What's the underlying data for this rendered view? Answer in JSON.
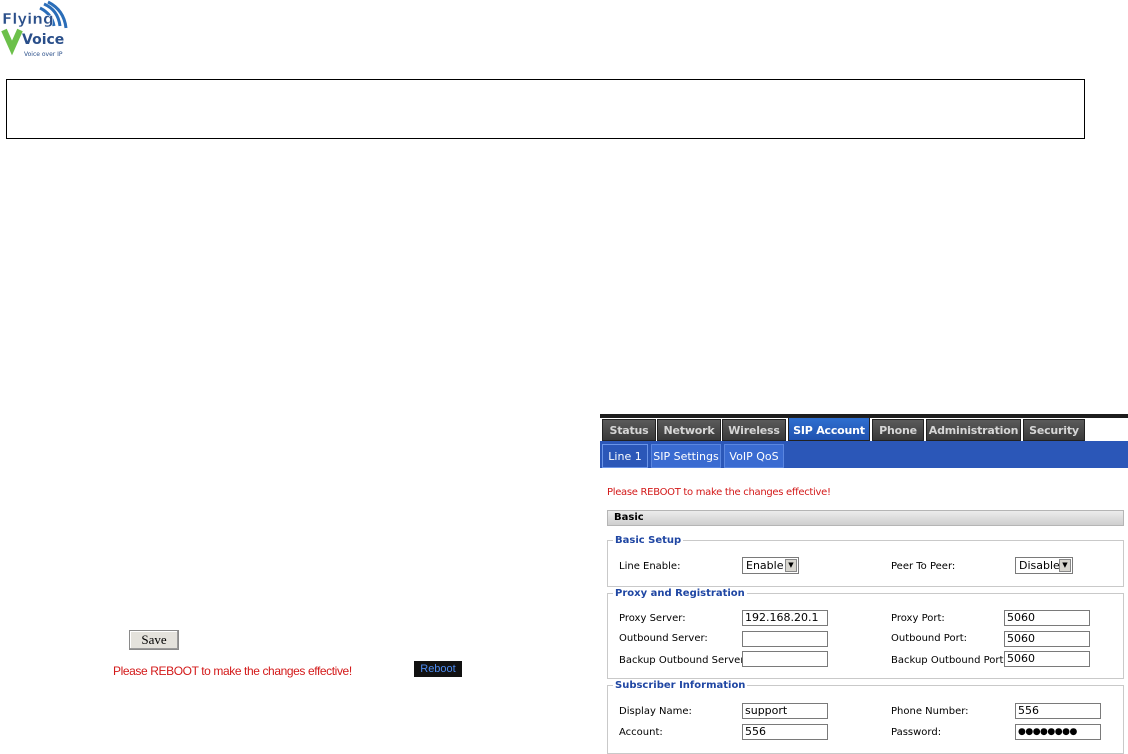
{
  "brand": {
    "line1": "Flying",
    "line2": "Voice",
    "tagline": "Voice over IP"
  },
  "left": {
    "save_label": "Save",
    "reboot_message": "Please REBOOT to make the changes effective!",
    "reboot_label": "Reboot"
  },
  "tabs": [
    {
      "label": "Status"
    },
    {
      "label": "Network"
    },
    {
      "label": "Wireless"
    },
    {
      "label": "SIP Account"
    },
    {
      "label": "Phone"
    },
    {
      "label": "Administration"
    },
    {
      "label": "Security"
    }
  ],
  "subtabs": [
    {
      "label": "Line 1"
    },
    {
      "label": "SIP Settings"
    },
    {
      "label": "VoIP QoS"
    }
  ],
  "panel": {
    "warning": "Please REBOOT to make the changes effective!",
    "section_title": "Basic",
    "basic_setup": {
      "legend": "Basic Setup",
      "line_enable_label": "Line Enable:",
      "line_enable_value": "Enable",
      "peer_to_peer_label": "Peer To Peer:",
      "peer_to_peer_value": "Disable"
    },
    "proxy": {
      "legend": "Proxy and Registration",
      "proxy_server_label": "Proxy Server:",
      "proxy_server_value": "192.168.20.1",
      "proxy_port_label": "Proxy Port:",
      "proxy_port_value": "5060",
      "outbound_server_label": "Outbound Server:",
      "outbound_server_value": "",
      "outbound_port_label": "Outbound Port:",
      "outbound_port_value": "5060",
      "backup_server_label": "Backup Outbound Server:",
      "backup_server_value": "",
      "backup_port_label": "Backup Outbound Port:",
      "backup_port_value": "5060"
    },
    "subscriber": {
      "legend": "Subscriber Information",
      "display_name_label": "Display Name:",
      "display_name_value": "support",
      "phone_number_label": "Phone Number:",
      "phone_number_value": "556",
      "account_label": "Account:",
      "account_value": "556",
      "password_label": "Password:",
      "password_value": "●●●●●●●●"
    }
  }
}
